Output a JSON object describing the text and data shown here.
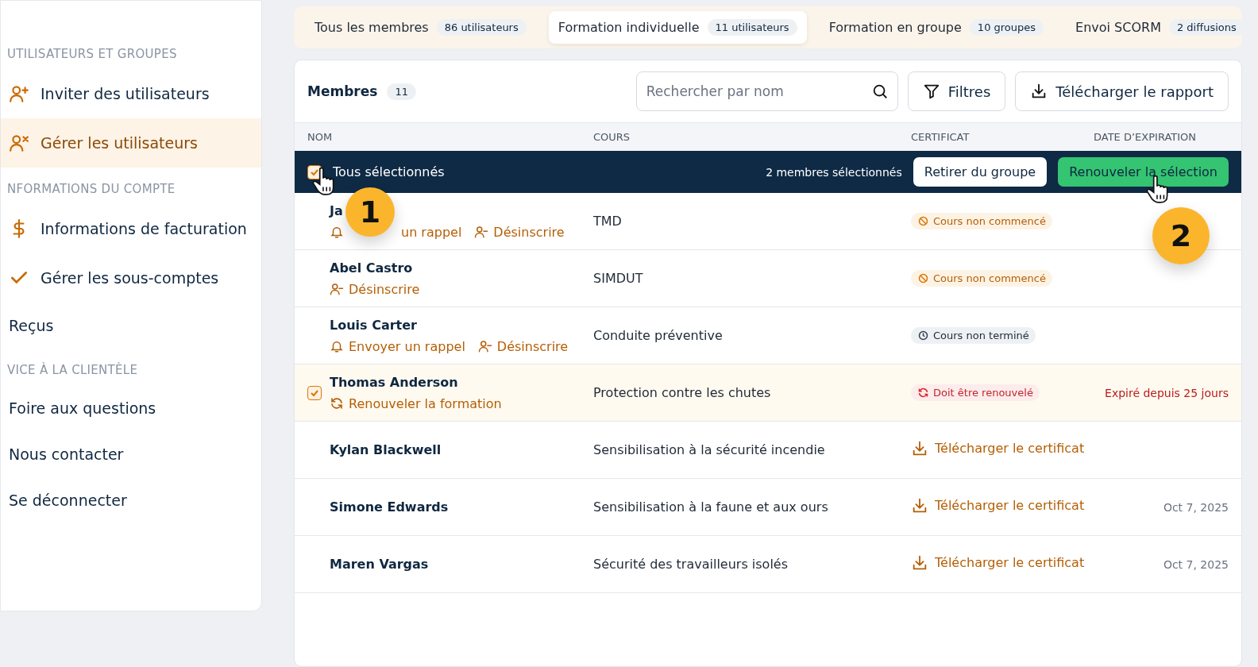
{
  "sidebar": {
    "sections": [
      {
        "heading": "UTILISATEURS ET GROUPES",
        "items": [
          {
            "label": "Inviter des utilisateurs",
            "kind": "invite",
            "selected": false
          },
          {
            "label": "Gérer les utilisateurs",
            "kind": "manage",
            "selected": true
          }
        ]
      },
      {
        "heading": "NFORMATIONS DU COMPTE",
        "items": [
          {
            "label": "Informations de facturation",
            "kind": "billing",
            "selected": false
          },
          {
            "label": "Gérer les sous-comptes",
            "kind": "subaccounts",
            "selected": false
          },
          {
            "label": "Reçus",
            "kind": "plain",
            "selected": false
          }
        ]
      },
      {
        "heading": "VICE À LA CLIENTÈLE",
        "items": [
          {
            "label": "Foire aux questions",
            "kind": "plain",
            "selected": false
          },
          {
            "label": "Nous contacter",
            "kind": "plain",
            "selected": false
          },
          {
            "label": "Se déconnecter",
            "kind": "plain",
            "selected": false
          }
        ]
      }
    ]
  },
  "tabs": [
    {
      "label": "Tous les membres",
      "count": "86 utilisateurs",
      "selected": false
    },
    {
      "label": "Formation individuelle",
      "count": "11 utilisateurs",
      "selected": true
    },
    {
      "label": "Formation en groupe",
      "count": "10 groupes",
      "selected": false
    },
    {
      "label": "Envoi SCORM",
      "count": "2 diffusions",
      "selected": false
    }
  ],
  "members": {
    "title": "Membres",
    "count": "11",
    "search": {
      "placeholder": "Rechercher par nom"
    },
    "filter_button": "Filtres",
    "report_button": "Télécharger le rapport"
  },
  "table": {
    "columns": [
      "NOM",
      "COURS",
      "CERTIFICAT",
      "DATE D’EXPIRATION"
    ],
    "selection_bar": {
      "all_label": "Tous sélectionnés",
      "all_checked": true,
      "count_text": "2 membres sélectionnés",
      "remove_button": "Retirer du groupe",
      "renew_button": "Renouveler la sélection"
    },
    "rows": [
      {
        "name": "Ja",
        "selected": false,
        "actions": [
          {
            "kind": "reminder",
            "label": "un rappel"
          },
          {
            "kind": "unenroll",
            "label": "Désinscrire"
          }
        ],
        "course": "TMD",
        "certificate": {
          "kind": "not-started",
          "label": "Cours non commencé"
        }
      },
      {
        "name": "Abel Castro",
        "selected": false,
        "actions": [
          {
            "kind": "unenroll",
            "label": "Désinscrire"
          }
        ],
        "course": "SIMDUT",
        "certificate": {
          "kind": "not-started",
          "label": "Cours non commencé"
        }
      },
      {
        "name": "Louis Carter",
        "selected": false,
        "actions": [
          {
            "kind": "reminder",
            "label": "Envoyer un rappel"
          },
          {
            "kind": "unenroll",
            "label": "Désinscrire"
          }
        ],
        "course": "Conduite préventive",
        "certificate": {
          "kind": "not-finished",
          "label": "Cours non terminé"
        }
      },
      {
        "name": "Thomas Anderson",
        "selected": true,
        "actions": [
          {
            "kind": "renew",
            "label": "Renouveler la formation"
          }
        ],
        "course": "Protection contre les chutes",
        "certificate": {
          "kind": "renew",
          "label": "Doit être renouvelé"
        },
        "expiry": {
          "text": "Expiré depuis 25 jours",
          "expired": true
        }
      },
      {
        "name": "Kylan Blackwell",
        "selected": false,
        "actions": [],
        "course": "Sensibilisation à la sécurité incendie",
        "certificate": {
          "kind": "download",
          "label": "Télécharger le certificat"
        }
      },
      {
        "name": "Simone Edwards",
        "selected": false,
        "actions": [],
        "course": "Sensibilisation à la faune et aux ours",
        "certificate": {
          "kind": "download",
          "label": "Télécharger le certificat"
        },
        "expiry": {
          "text": "Oct 7, 2025",
          "expired": false
        }
      },
      {
        "name": "Maren Vargas",
        "selected": false,
        "actions": [],
        "course": "Sécurité des travailleurs isolés",
        "certificate": {
          "kind": "download",
          "label": "Télécharger le certificat"
        },
        "expiry": {
          "text": "Oct 7, 2025",
          "expired": false
        }
      }
    ]
  },
  "callouts": [
    "1",
    "2"
  ]
}
